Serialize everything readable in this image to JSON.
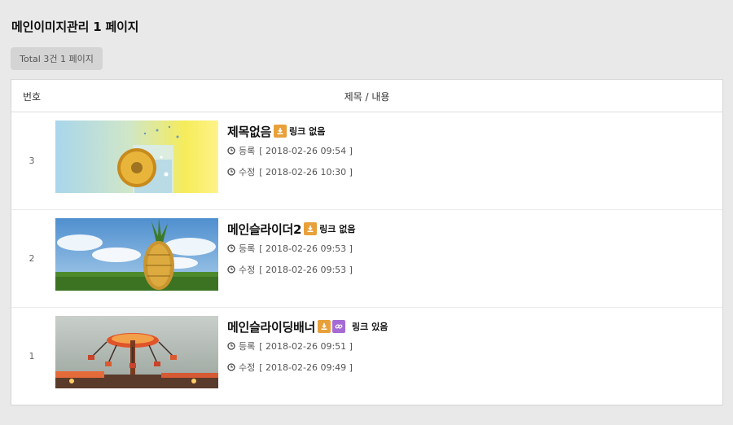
{
  "page": {
    "title": "메인이미지관리 1 페이지",
    "total": "Total 3건 1 페이지"
  },
  "table": {
    "col_num": "번호",
    "col_title": "제목 / 내용"
  },
  "labels": {
    "registered": "등록",
    "modified": "수정"
  },
  "items": [
    {
      "num": "3",
      "title": "제목없음",
      "link_status": "링크 없음",
      "registered": "[ 2018-02-26 09:54 ]",
      "modified": "[ 2018-02-26 10:30 ]",
      "icons": [
        "download-icon"
      ]
    },
    {
      "num": "2",
      "title": "메인슬라이더2",
      "link_status": "링크 없음",
      "registered": "[ 2018-02-26 09:53 ]",
      "modified": "[ 2018-02-26 09:53 ]",
      "icons": [
        "download-icon"
      ]
    },
    {
      "num": "1",
      "title": "메인슬라이딩배너",
      "link_status": "링크 있음",
      "registered": "[ 2018-02-26 09:51 ]",
      "modified": "[ 2018-02-26 09:49 ]",
      "icons": [
        "download-icon",
        "link-icon"
      ]
    }
  ],
  "colors": {
    "download_badge": "#e8a13a",
    "link_badge": "#a56ad4",
    "background": "#e9e9e9"
  }
}
